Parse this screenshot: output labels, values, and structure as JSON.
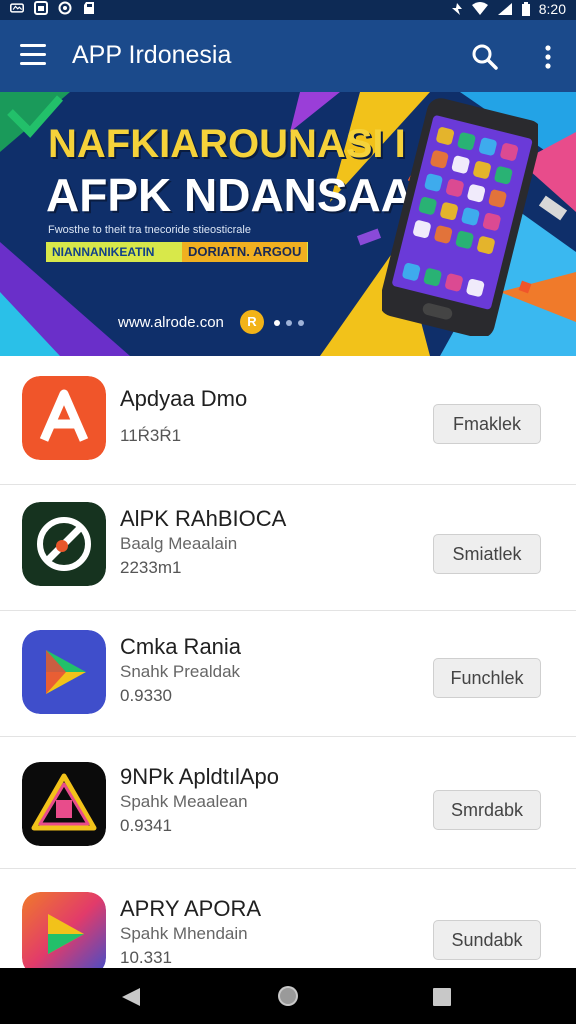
{
  "status_bar": {
    "time": "8:20",
    "left_icons": [
      "notification-icon",
      "photo-icon",
      "sync-icon",
      "sd-card-icon"
    ],
    "right_icons": [
      "data-icon",
      "wifi-icon",
      "signal-icon",
      "battery-icon"
    ]
  },
  "app_bar": {
    "title": "APP Irdonesia",
    "icons": [
      "menu-icon",
      "search-icon",
      "more-vert-icon"
    ]
  },
  "banner": {
    "headline_top": "NAFKIAROUNASI I",
    "headline_main": "AFPK NDANSAA",
    "subtext": "Fwosthe to theit tra tnecoride stieosticrale",
    "strip_left": "NIANNANIKEATIN",
    "strip_right": "DORIATN. ARGOU",
    "url": "www.alrode.con",
    "coin_label": "R",
    "page_dots": 3,
    "active_dot": 0,
    "colors": {
      "background": "#0f2f6a",
      "headline": "#f5d23a",
      "strip": "#d8e84a"
    }
  },
  "apps": [
    {
      "name": "Apdyaa Dmo",
      "category": "",
      "size": "11Ŕ3Ŕ1",
      "button": "Fmaklek",
      "icon": "letter-a-app-icon",
      "icon_color": "#f0552a"
    },
    {
      "name": "AlPK RAhBIOCA",
      "category": "Baalg Meaalain",
      "size": "2233m1",
      "button": "Smiatlek",
      "icon": "pin-app-icon",
      "icon_color": "#16331f"
    },
    {
      "name": "Cmka Rania",
      "category": "Snahk Prealdak",
      "size": "0.9330",
      "button": "Funchlek",
      "icon": "play-triangle-app-icon",
      "icon_color": "#3f4ecb"
    },
    {
      "name": "9NPk ApldtılApo",
      "category": "Spahk Meaalean",
      "size": "0.9341",
      "button": "Smrdabk",
      "icon": "warning-triangle-app-icon",
      "icon_color": "#0b0b0b"
    },
    {
      "name": "APRY APORA",
      "category": "Spahk Mhendain",
      "size": "10.331",
      "button": "Sundabk",
      "icon": "gradient-play-app-icon",
      "icon_color": "#e23b6a"
    }
  ],
  "nav_bar": {
    "icons": [
      "back-icon",
      "home-icon",
      "recents-icon"
    ]
  }
}
